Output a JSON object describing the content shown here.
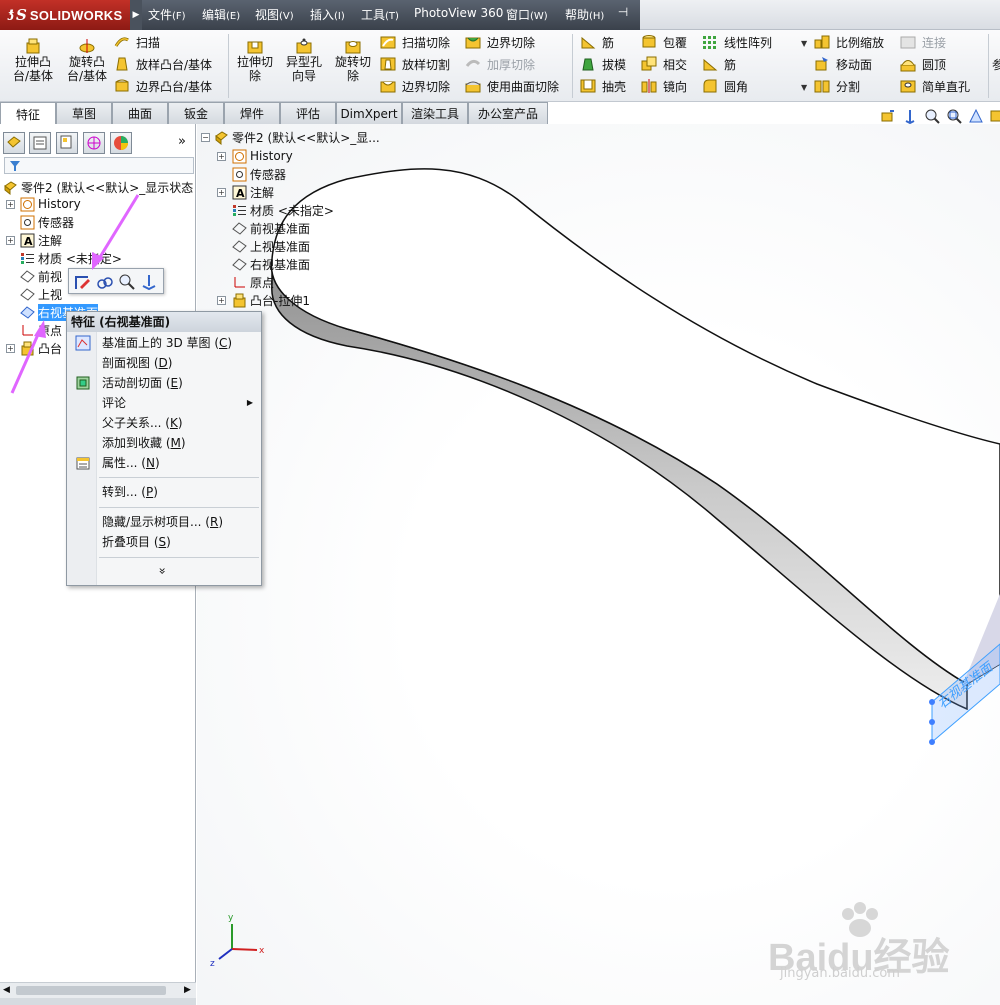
{
  "app": {
    "logo_ds": "ƾS",
    "logo_name": "SOLIDWORKS"
  },
  "menu": [
    {
      "label": "文件",
      "key": "(F)"
    },
    {
      "label": "编辑",
      "key": "(E)"
    },
    {
      "label": "视图",
      "key": "(V)"
    },
    {
      "label": "插入",
      "key": "(I)"
    },
    {
      "label": "工具",
      "key": "(T)"
    },
    {
      "label": "PhotoView 360",
      "key": ""
    },
    {
      "label": "窗口",
      "key": "(W)"
    },
    {
      "label": "帮助",
      "key": "(H)"
    }
  ],
  "commands": {
    "extrude_boss": "拉伸凸\n台/基体",
    "revolve_boss": "旋转凸\n台/基体",
    "sweep": "扫描",
    "loft_boss": "放样凸台/基体",
    "boundary_boss": "边界凸台/基体",
    "extrude_cut": "拉伸切\n除",
    "hole_wizard": "异型孔\n向导",
    "revolve_cut": "旋转切\n除",
    "sweep_cut": "扫描切除",
    "loft_cut": "放样切割",
    "boundary_cut": "边界切除",
    "boundary_cut2": "边界切除",
    "thicken_cut": "加厚切除",
    "surface_cut": "使用曲面切除",
    "rib": "筋",
    "draft": "拔模",
    "shell": "抽壳",
    "wrap": "包覆",
    "intersect": "相交",
    "mirror": "镜向",
    "linear_pattern": "线性阵列",
    "rib2": "筋",
    "fillet": "圆角",
    "scale": "比例缩放",
    "move_face": "移动面",
    "split": "分割",
    "connect": "连接",
    "dome": "圆顶",
    "simple_hole": "简单直孔",
    "more": "参"
  },
  "tabs": [
    "特征",
    "草图",
    "曲面",
    "钣金",
    "焊件",
    "评估",
    "DimXpert",
    "渲染工具",
    "办公室产品"
  ],
  "tree": {
    "part": "零件2 (默认<<默认>_显示状态",
    "history": "History",
    "sensors": "传感器",
    "annotations": "注解",
    "material": "材质 <未指定>",
    "front_plane": "前视",
    "top_plane": "上视",
    "right_plane": "右视基准面",
    "origin": "原点",
    "boss": "凸台"
  },
  "gfx_tree": {
    "part": "零件2 (默认<<默认>_显...",
    "history": "History",
    "sensors": "传感器",
    "annotations": "注解",
    "material": "材质 <未指定>",
    "front_plane": "前视基准面",
    "top_plane": "上视基准面",
    "right_plane": "右视基准面",
    "origin": "原点",
    "boss": "凸台-拉伸1"
  },
  "context_menu": {
    "title": "特征 (右视基准面)",
    "items": [
      {
        "label": "基准面上的 3D 草图 (",
        "key": "C",
        "tail": ")"
      },
      {
        "label": "剖面视图 (",
        "key": "D",
        "tail": ")"
      },
      {
        "label": "活动剖切面 (",
        "key": "E",
        "tail": ")"
      },
      {
        "label": "评论",
        "key": "",
        "tail": ""
      },
      {
        "label": "父子关系... (",
        "key": "K",
        "tail": ")"
      },
      {
        "label": "添加到收藏 (",
        "key": "M",
        "tail": ")"
      },
      {
        "label": "属性... (",
        "key": "N",
        "tail": ")"
      },
      {
        "label": "转到... (",
        "key": "P",
        "tail": ")"
      },
      {
        "label": "隐藏/显示树项目... (",
        "key": "R",
        "tail": ")"
      },
      {
        "label": "折叠项目 (",
        "key": "S",
        "tail": ")"
      }
    ],
    "expand": "»"
  },
  "plane_label": "右视基准面",
  "triad": {
    "x": "x",
    "y": "y",
    "z": "z"
  },
  "watermark": {
    "brand": "Baidu经验",
    "url": "jingyan.baidu.com"
  },
  "colors": {
    "accent": "#3399ff",
    "annotation_arrow": "#e066ff",
    "plane": "#3fa0ff"
  }
}
